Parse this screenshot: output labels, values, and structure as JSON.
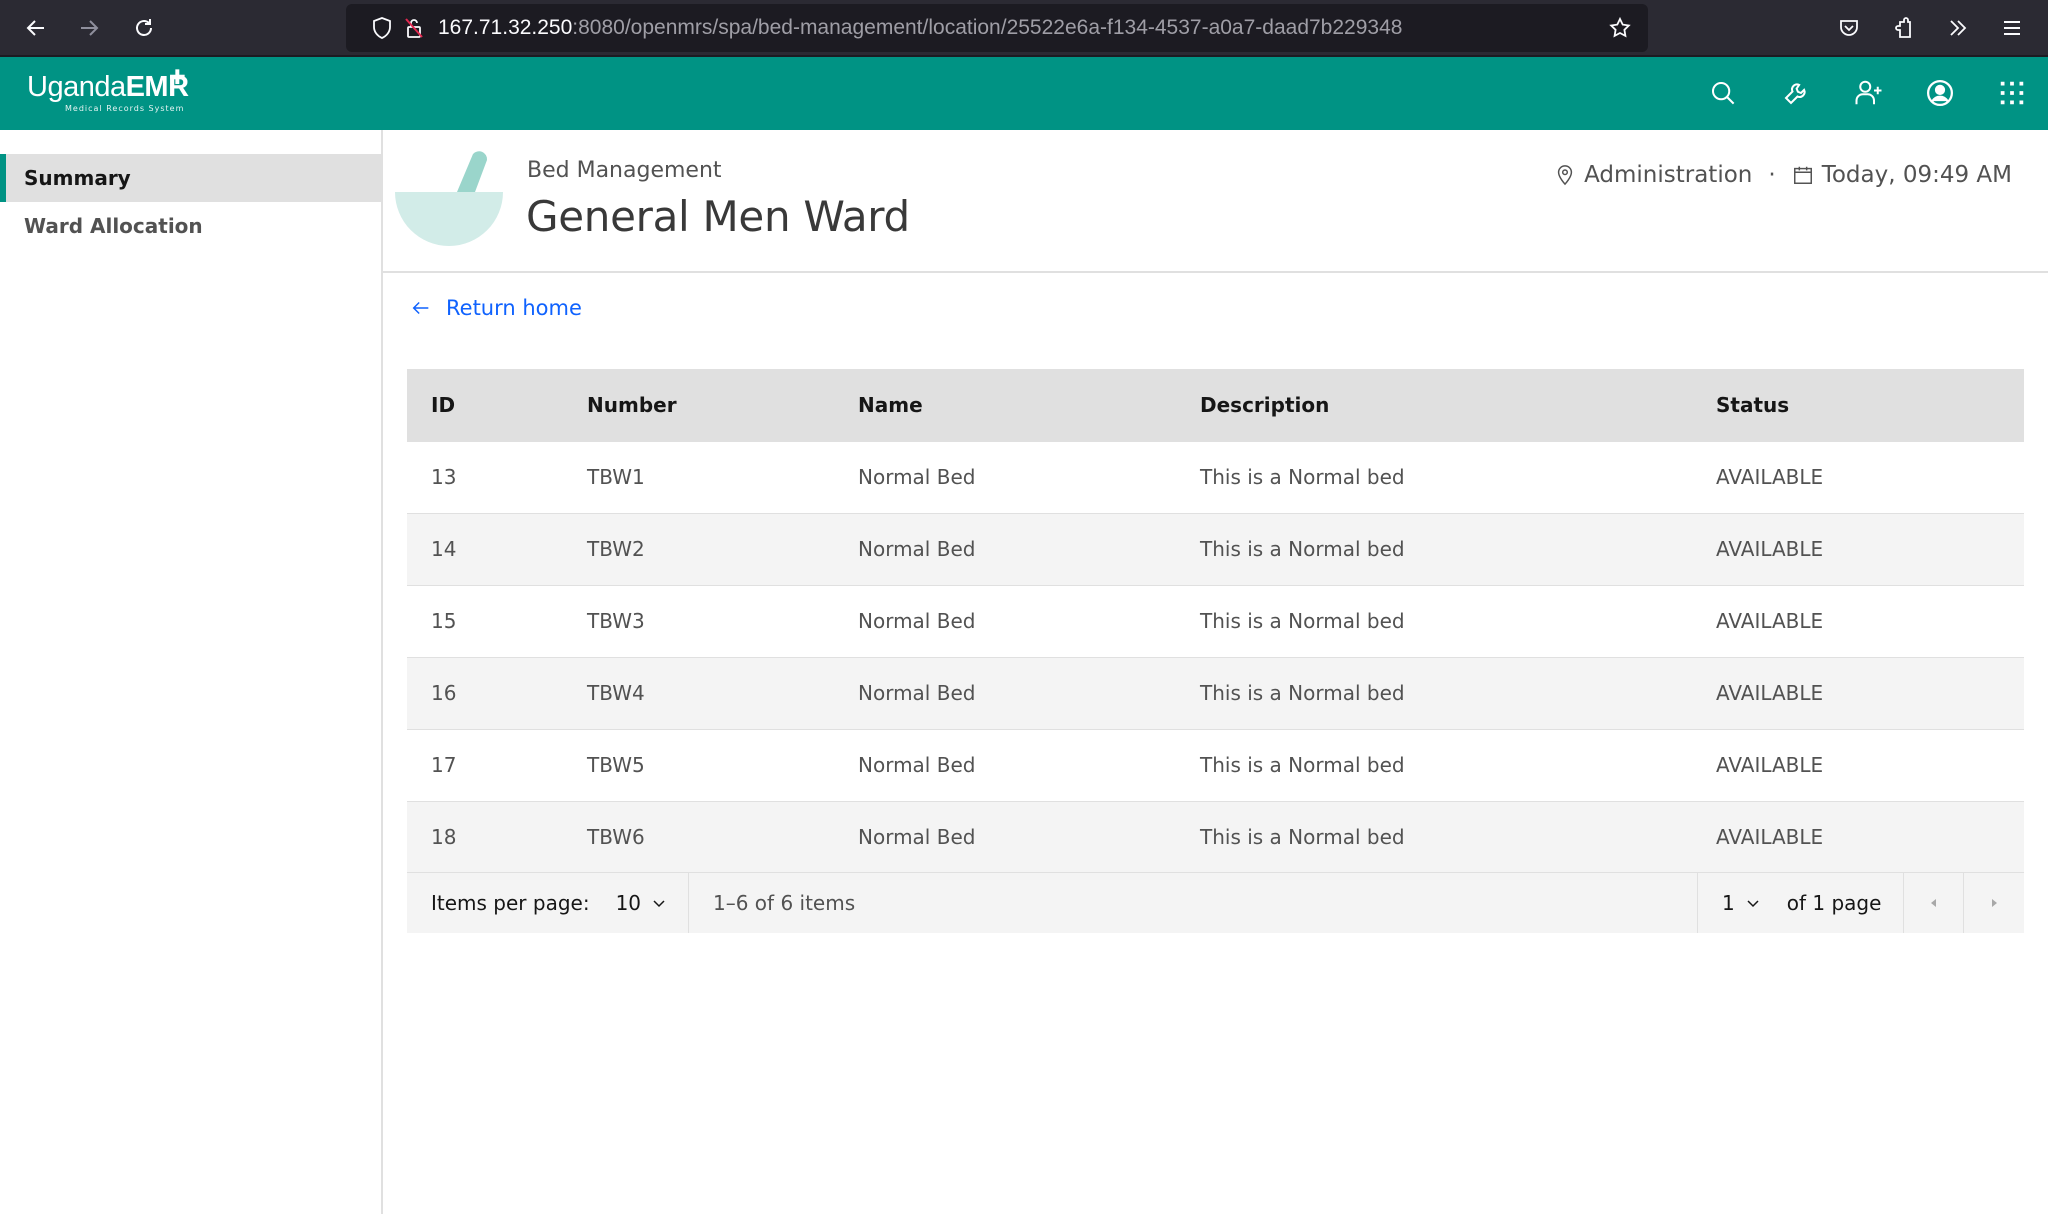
{
  "browser": {
    "url_host": "167.71.32.250",
    "url_rest": ":8080/openmrs/spa/bed-management/location/25522e6a-f134-4537-a0a7-daad7b229348",
    "icons": [
      "back-icon",
      "forward-icon",
      "reload-icon",
      "shield-icon",
      "insecure-lock-icon",
      "bookmark-star-icon",
      "pocket-icon",
      "extensions-icon",
      "overflow-chevrons-icon",
      "menu-icon"
    ]
  },
  "app": {
    "logo_text_light": "Uganda",
    "logo_text_bold": "EMR",
    "logo_subtitle": "Medical Records System",
    "brand_color": "#009384",
    "header_icons": [
      "search-icon",
      "wrench-icon",
      "add-user-icon",
      "user-avatar-icon",
      "app-switcher-icon"
    ]
  },
  "sidebar": {
    "items": [
      {
        "label": "Summary",
        "active": true
      },
      {
        "label": "Ward Allocation",
        "active": false
      }
    ]
  },
  "page_header": {
    "subtitle": "Bed Management",
    "title": "General Men Ward",
    "location": "Administration",
    "separator": "·",
    "datetime": "Today, 09:49 AM"
  },
  "return_link": {
    "label": "Return home",
    "color": "#0f62fe"
  },
  "table": {
    "columns": [
      "ID",
      "Number",
      "Name",
      "Description",
      "Status"
    ],
    "rows": [
      {
        "id": "13",
        "number": "TBW1",
        "name": "Normal Bed",
        "description": "This is a Normal bed",
        "status": "AVAILABLE"
      },
      {
        "id": "14",
        "number": "TBW2",
        "name": "Normal Bed",
        "description": "This is a Normal bed",
        "status": "AVAILABLE"
      },
      {
        "id": "15",
        "number": "TBW3",
        "name": "Normal Bed",
        "description": "This is a Normal bed",
        "status": "AVAILABLE"
      },
      {
        "id": "16",
        "number": "TBW4",
        "name": "Normal Bed",
        "description": "This is a Normal bed",
        "status": "AVAILABLE"
      },
      {
        "id": "17",
        "number": "TBW5",
        "name": "Normal Bed",
        "description": "This is a Normal bed",
        "status": "AVAILABLE"
      },
      {
        "id": "18",
        "number": "TBW6",
        "name": "Normal Bed",
        "description": "This is a Normal bed",
        "status": "AVAILABLE"
      }
    ]
  },
  "pagination": {
    "items_per_page_label": "Items per page:",
    "items_per_page_value": "10",
    "range_text": "1–6 of 6 items",
    "current_page": "1",
    "of_pages_text": "of 1 page"
  }
}
